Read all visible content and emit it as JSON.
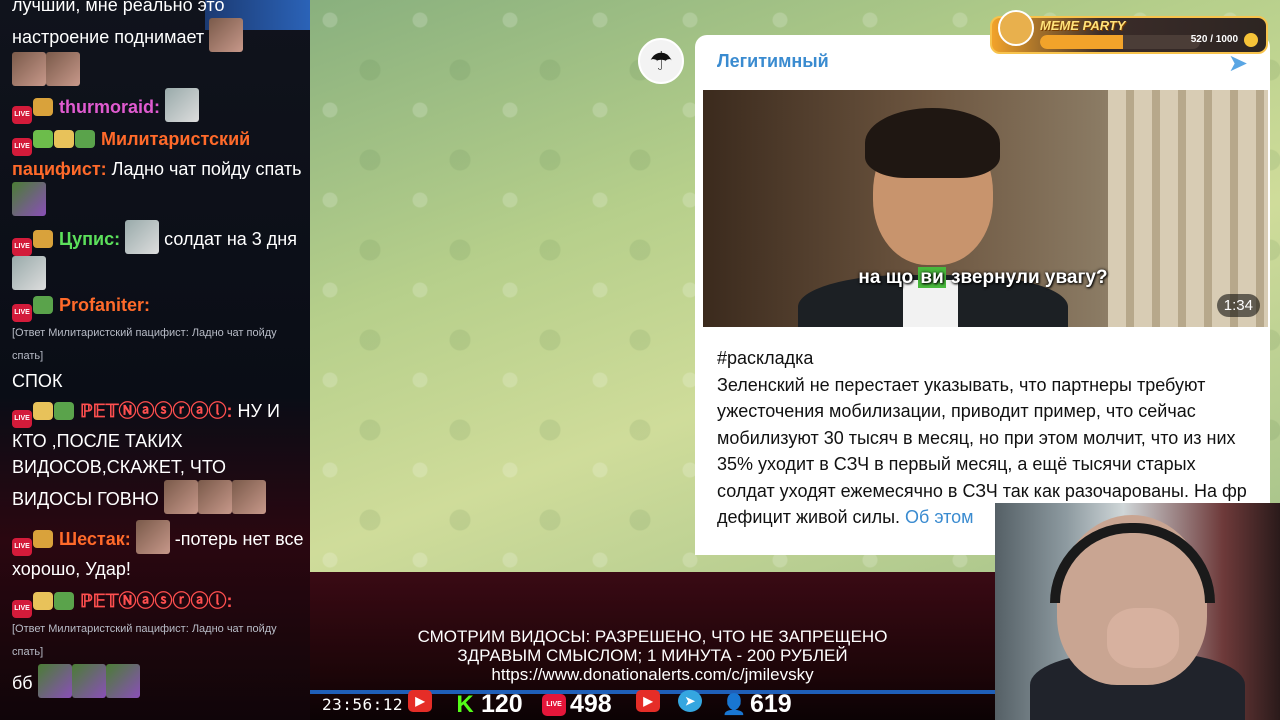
{
  "chat": {
    "messages": [
      {
        "nick": "",
        "text": "лучший, мне реально это настроение поднимает"
      },
      {
        "nick": "thurmoraid:",
        "text": ""
      },
      {
        "nick": "Милитаристский пацифист:",
        "text": "Ладно чат пойду спать"
      },
      {
        "nick": "Цупис:",
        "text": "солдат на 3 дня"
      },
      {
        "nick": "Profaniter:",
        "reply": "[Ответ Милитаристский пацифист: Ладно чат пойду спать]",
        "text": "СПОК"
      },
      {
        "nick": "ℙ𝔼𝕋Ⓝⓐⓢⓡⓐⓛ:",
        "text": "НУ И КТО ,ПОСЛЕ ТАКИХ ВИДОСОВ,СКАЖЕТ, ЧТО ВИДОСЫ ГОВНО"
      },
      {
        "nick": "Шестак:",
        "text": "-потерь нет все хорошо, Удар!"
      },
      {
        "nick": "ℙ𝔼𝕋Ⓝⓐⓢⓡⓐⓛ:",
        "reply": "[Ответ Милитаристский пацифист: Ладно чат пойду спать]",
        "text": "бб"
      }
    ],
    "live_badge": "LIVE"
  },
  "telegram": {
    "channel_name": "Легитимный",
    "video": {
      "subtitle_highlight": "ви",
      "subtitle_pre": "на що ",
      "subtitle_post": " звернули увагу?",
      "duration": "1:34"
    },
    "post": {
      "hashtag": "#раскладка",
      "body": "Зеленский не перестает указывать, что партнеры требуют ужесточения мобилизации, приводит пример, что сейчас мобилизуют 30 тысяч в месяц, но при этом молчит, что из них 35% уходит в СЗЧ в первый месяц, а ещё тысячи старых солдат уходят ежемесячно в СЗЧ так как разочарованы. На фр",
      "tail": "дефицит живой силы.",
      "more_link": "Об этом"
    },
    "colors": {
      "link": "#3a8bd0",
      "background": "#b6cf8b"
    }
  },
  "widget": {
    "title": "MEME PARTY",
    "progress_text": "520 / 1000",
    "progress_fraction": 0.52
  },
  "banner": {
    "line1": "СМОТРИМ ВИДОСЫ: РАЗРЕШЕНО, ЧТО НЕ ЗАПРЕЩЕНО",
    "line2": "ЗДРАВЫМ СМЫСЛОМ; 1 МИНУТА - 200 РУБЛЕЙ",
    "line3": "https://www.donationalerts.com/c/jmilevsky"
  },
  "status_bar": {
    "clock": "23:56:12",
    "kick_count": "120",
    "vk_count": "498",
    "viewers": "619",
    "icons": [
      "youtube-icon",
      "kick-icon",
      "vk-live-icon",
      "youtube-icon",
      "telegram-icon",
      "viewers-icon"
    ]
  }
}
